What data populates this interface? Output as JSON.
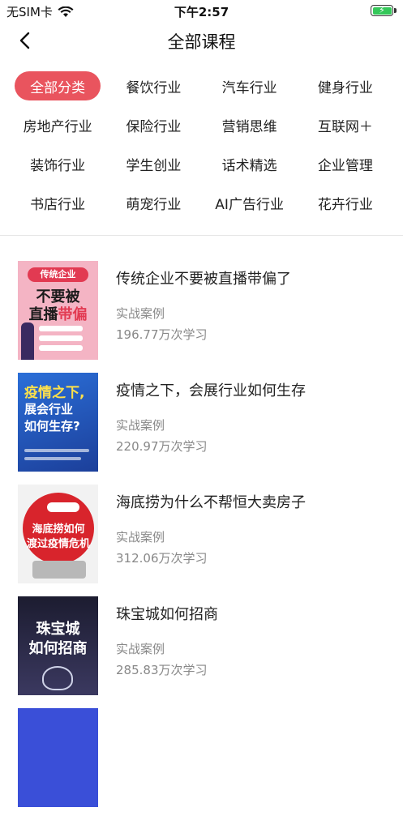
{
  "status_bar": {
    "carrier": "无SIM卡",
    "time": "下午2:57"
  },
  "nav": {
    "title": "全部课程"
  },
  "categories": [
    {
      "label": "全部分类",
      "active": true
    },
    {
      "label": "餐饮行业",
      "active": false
    },
    {
      "label": "汽车行业",
      "active": false
    },
    {
      "label": "健身行业",
      "active": false
    },
    {
      "label": "房地产行业",
      "active": false
    },
    {
      "label": "保险行业",
      "active": false
    },
    {
      "label": "营销思维",
      "active": false
    },
    {
      "label": "互联网＋",
      "active": false
    },
    {
      "label": "装饰行业",
      "active": false
    },
    {
      "label": "学生创业",
      "active": false
    },
    {
      "label": "话术精选",
      "active": false
    },
    {
      "label": "企业管理",
      "active": false
    },
    {
      "label": "书店行业",
      "active": false
    },
    {
      "label": "萌宠行业",
      "active": false
    },
    {
      "label": "AI广告行业",
      "active": false
    },
    {
      "label": "花卉行业",
      "active": false
    }
  ],
  "courses": [
    {
      "title": "传统企业不要被直播带偏了",
      "tag": "实战案例",
      "views": "196.77万次学习",
      "thumb_text": [
        "传统企业",
        "不要被",
        "直播",
        "带偏"
      ]
    },
    {
      "title": "疫情之下，会展行业如何生存",
      "tag": "实战案例",
      "views": "220.97万次学习",
      "thumb_text": [
        "疫情之下,",
        "展会行业",
        "如何生存?"
      ]
    },
    {
      "title": "海底捞为什么不帮恒大卖房子",
      "tag": "实战案例",
      "views": "312.06万次学习",
      "thumb_text": [
        "海底捞如何",
        "渡过疫情危机"
      ]
    },
    {
      "title": "珠宝城如何招商",
      "tag": "实战案例",
      "views": "285.83万次学习",
      "thumb_text": [
        "珠宝城",
        "如何招商"
      ]
    }
  ],
  "colors": {
    "accent": "#e9545e",
    "battery": "#34c759"
  }
}
